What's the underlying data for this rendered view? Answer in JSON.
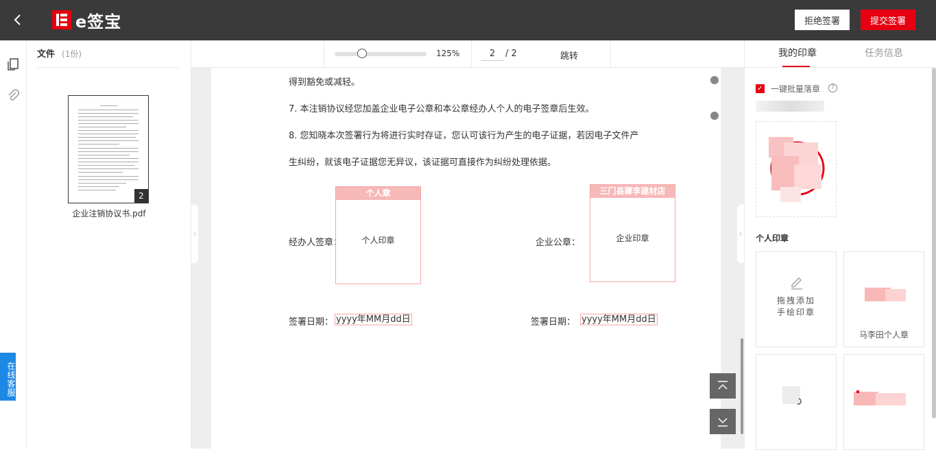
{
  "header": {
    "logo_text": "e签宝",
    "reject_label": "拒绝签署",
    "submit_label": "提交签署",
    "brand_color": "#e60012"
  },
  "sidebar": {
    "service_label": "在线客服"
  },
  "file_panel": {
    "title": "文件",
    "count": "(1份)",
    "thumbnail_page_badge": "2",
    "file_name": "企业注销协议书.pdf"
  },
  "toolbar": {
    "zoom_percent": 125,
    "zoom_label": "125%",
    "current_page": "2",
    "total_pages": "/ 2",
    "jump_label": "跳转"
  },
  "document": {
    "paragraphs": [
      "得到豁免或减轻。",
      "7.  本注销协议经您加盖企业电子公章和本公章经办人个人的电子签章后生效。",
      "8. 您知晓本次签署行为将进行实时存证，您认可该行为产生的电子证据，若因电子文件产",
      "生纠纷，就该电子证据您无异议，该证据可直接作为纠纷处理依据。"
    ],
    "personal_seal": {
      "label": "经办人签章：",
      "header": "个人章",
      "placeholder": "个人印章"
    },
    "company_seal": {
      "label": "企业公章：",
      "header": "三门县骤李建材店",
      "placeholder": "企业印章"
    },
    "date_label_left": "签署日期：",
    "date_value_left": "yyyy年MM月dd日",
    "date_label_right": "签署日期：",
    "date_value_right": "yyyy年MM月dd日"
  },
  "right_panel": {
    "tabs": [
      "我的印章",
      "任务信息"
    ],
    "active_tab": 0,
    "batch_label": "一键批量落章",
    "batch_checked": true,
    "personal_seals_title": "个人印章",
    "draw_seal_label_1": "拖拽添加",
    "draw_seal_label_2": "手绘印章",
    "seal_name": "马李田个人章"
  }
}
